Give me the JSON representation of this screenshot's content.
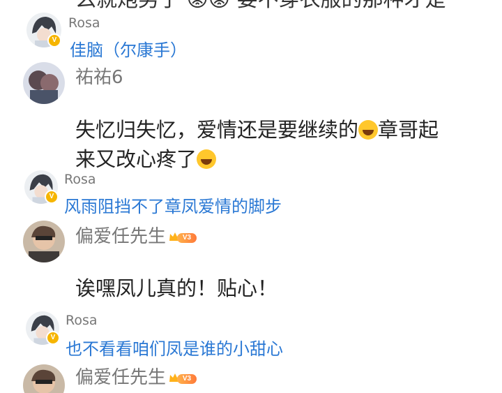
{
  "top_fragment": "么就炮男子 😡😡 要不穿衣服的那种才是",
  "comments": [
    {
      "user": "Rosa",
      "kind": "reply",
      "text": "佳脑（尔康手）"
    },
    {
      "user": "祐祐6",
      "kind": "main",
      "line1": "失忆归失忆，爱情还是要继续的",
      "line1b": "章哥起",
      "line2": "来又改心疼了"
    },
    {
      "user": "Rosa",
      "kind": "reply",
      "text": "风雨阻挡不了章凤爱情的脚步"
    },
    {
      "user": "偏爱任先生",
      "kind": "main",
      "badge": "V3",
      "text": "诶嘿凤儿真的！贴心！"
    },
    {
      "user": "Rosa",
      "kind": "reply",
      "text": "也不看看咱们凤是谁的小甜心"
    },
    {
      "user": "偏爱任先生",
      "kind": "main",
      "badge": "V3"
    }
  ],
  "icons": {
    "verified": "verified-badge-icon",
    "laugh": "laughing-emoji-icon",
    "crown": "crown-icon"
  },
  "colors": {
    "reply_text": "#2a78d4",
    "username": "#777777",
    "verified": "#f6b500"
  }
}
